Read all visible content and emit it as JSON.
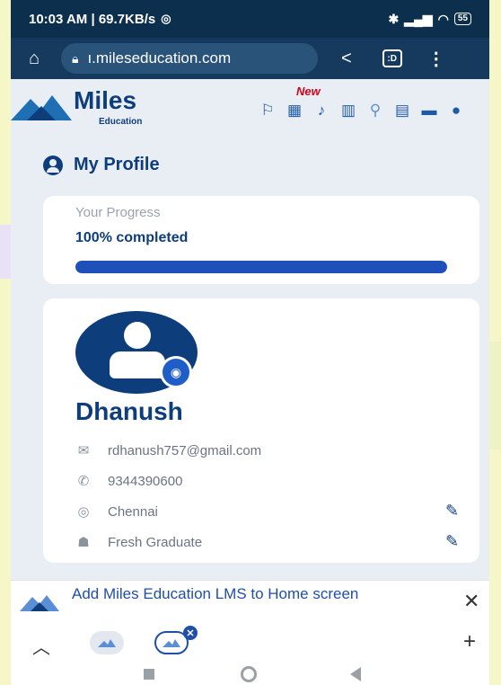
{
  "status_bar": {
    "time_speed": "10:03 AM | 69.7KB/s",
    "battery": "55"
  },
  "browser": {
    "url": "ı.mileseducation.com"
  },
  "site": {
    "logo_name": "Miles",
    "logo_sub": "Education",
    "new_label": "New"
  },
  "profile": {
    "heading": "My Profile",
    "progress_label": "Your Progress",
    "progress_value_text": "100% completed",
    "progress_fraction": 1.0,
    "name": "Dhanush",
    "email": "rdhanush757@gmail.com",
    "phone": "9344390600",
    "city": "Chennai",
    "status": "Fresh Graduate"
  },
  "banner": {
    "text": "Add Miles Education LMS to Home screen"
  },
  "colors": {
    "brand_navy": "#0d3d7a",
    "progress_blue": "#1f4fb9",
    "status_bar": "#0b2f4c",
    "url_bar": "#163a5d"
  }
}
